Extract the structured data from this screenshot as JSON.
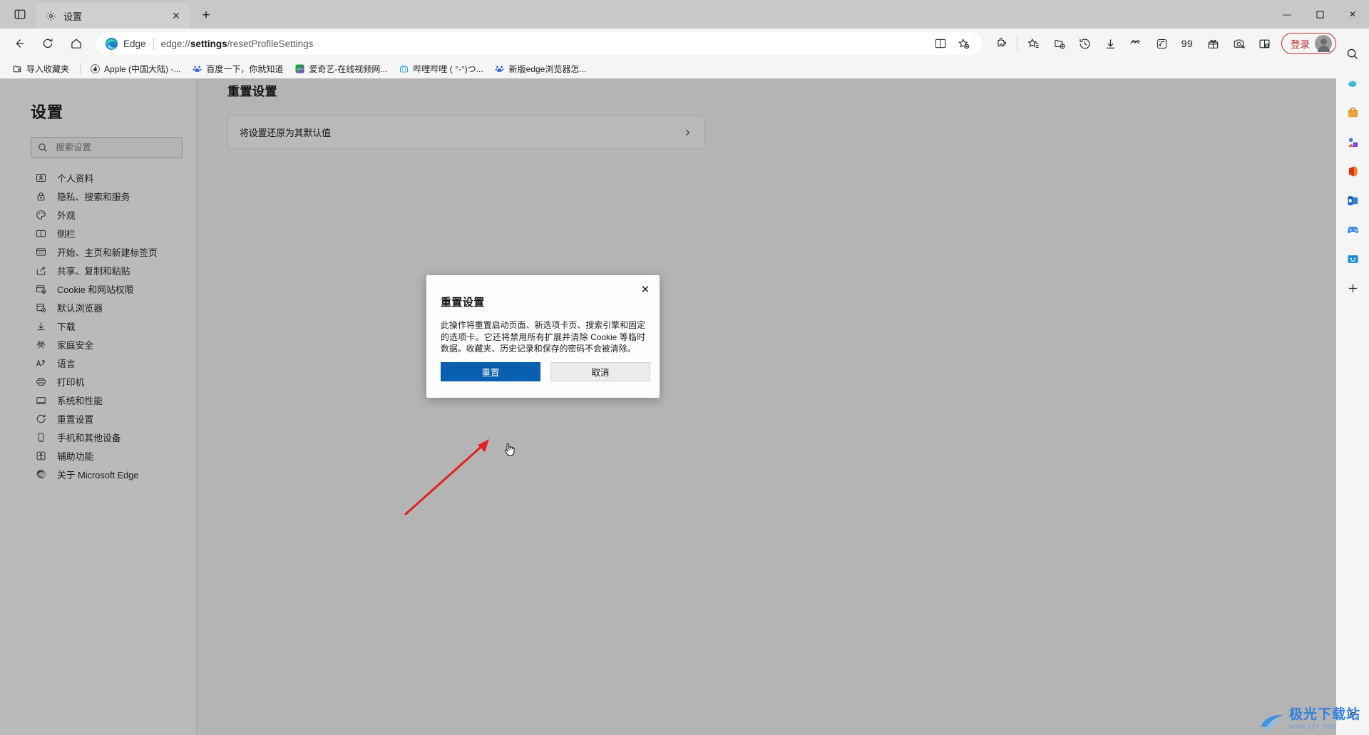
{
  "window": {
    "controls": {
      "minimize": "—",
      "maximize": "☐",
      "close": "✕"
    }
  },
  "tabstrip": {
    "tab_search_icon": "tab-search-icon",
    "tabs": [
      {
        "title": "设置",
        "icon": "gear-icon",
        "close_label": "✕",
        "active": true
      }
    ],
    "new_tab_label": "+"
  },
  "navbar": {
    "back_label": "←",
    "refresh_label": "↻",
    "home_label": "home-icon",
    "omnibox": {
      "brand": "Edge",
      "url_prefix": "edge://",
      "url_bold": "settings",
      "url_suffix": "/resetProfileSettings",
      "url_full": "edge://settings/resetProfileSettings",
      "split_screen_icon": "split-screen-icon",
      "favorite_icon": "add-favorite-icon"
    },
    "toolbar_icons": [
      {
        "name": "extensions-icon"
      },
      {
        "name": "collections-icon"
      },
      {
        "name": "add-to-collection-icon"
      },
      {
        "name": "history-icon"
      },
      {
        "name": "downloads-icon"
      },
      {
        "name": "performance-icon"
      },
      {
        "name": "math-solver-icon"
      }
    ],
    "badge_text": "99",
    "right_icons": [
      {
        "name": "gift-rewards-icon"
      },
      {
        "name": "screenshot-icon"
      },
      {
        "name": "split-window-icon"
      }
    ],
    "signin": {
      "label": "登录",
      "accent": "#c22f2f"
    },
    "more_label": "⋯"
  },
  "bookmarks": {
    "import_label": "导入收藏夹",
    "items": [
      {
        "label": "Apple (中国大陆) -...",
        "icon": "apple-icon",
        "color": "#2b2b2b"
      },
      {
        "label": "百度一下，你就知道",
        "icon": "baidu-icon",
        "color": "#2b5fd9"
      },
      {
        "label": "爱奇艺-在线视频网...",
        "icon": "iqiyi-icon",
        "color": "#00be06"
      },
      {
        "label": "哔哩哔哩 ( °-°)つ...",
        "icon": "bilibili-icon",
        "color": "#23ade5"
      },
      {
        "label": "新版edge浏览器怎...",
        "icon": "baidu-icon",
        "color": "#2b5fd9"
      }
    ]
  },
  "sidebar": {
    "title": "设置",
    "search": {
      "placeholder": "搜索设置",
      "value": "",
      "icon": "search-icon"
    },
    "items": [
      {
        "label": "个人资料",
        "icon": "profile-icon"
      },
      {
        "label": "隐私、搜索和服务",
        "icon": "lock-icon"
      },
      {
        "label": "外观",
        "icon": "palette-icon"
      },
      {
        "label": "侧栏",
        "icon": "sidebar-icon"
      },
      {
        "label": "开始、主页和新建标签页",
        "icon": "startpage-icon"
      },
      {
        "label": "共享、复制和粘贴",
        "icon": "share-icon"
      },
      {
        "label": "Cookie 和网站权限",
        "icon": "cookie-permissions-icon"
      },
      {
        "label": "默认浏览器",
        "icon": "default-browser-icon"
      },
      {
        "label": "下载",
        "icon": "download-icon"
      },
      {
        "label": "家庭安全",
        "icon": "family-safety-icon"
      },
      {
        "label": "语言",
        "icon": "language-icon"
      },
      {
        "label": "打印机",
        "icon": "printer-icon"
      },
      {
        "label": "系统和性能",
        "icon": "system-icon"
      },
      {
        "label": "重置设置",
        "icon": "reset-icon"
      },
      {
        "label": "手机和其他设备",
        "icon": "phone-icon"
      },
      {
        "label": "辅助功能",
        "icon": "accessibility-icon"
      },
      {
        "label": "关于 Microsoft Edge",
        "icon": "edge-logo-icon"
      }
    ]
  },
  "content": {
    "title": "重置设置",
    "reset_card": {
      "label": "将设置还原为其默认值",
      "chevron": "chevron-right-icon"
    }
  },
  "dialog": {
    "title": "重置设置",
    "body": "此操作将重置启动页面、新选项卡页、搜索引擎和固定的选项卡。它还将禁用所有扩展并清除 Cookie 等临时数据。收藏夹、历史记录和保存的密码不会被清除。",
    "confirm_label": "重置",
    "cancel_label": "取消",
    "close_label": "✕",
    "confirm_color": "#0a5fae"
  },
  "siderail": {
    "items": [
      {
        "name": "search-rail-icon"
      },
      {
        "name": "copilot-rail-icon"
      },
      {
        "name": "shopping-rail-icon"
      },
      {
        "name": "tools-rail-icon"
      },
      {
        "name": "office-rail-icon"
      },
      {
        "name": "outlook-rail-icon"
      },
      {
        "name": "games-rail-icon"
      },
      {
        "name": "dropbox-rail-icon"
      },
      {
        "name": "add-rail-icon"
      }
    ],
    "settings_icon": "rail-settings-icon"
  },
  "watermark": {
    "main": "极光下载站",
    "sub": "www.xz7.com"
  }
}
